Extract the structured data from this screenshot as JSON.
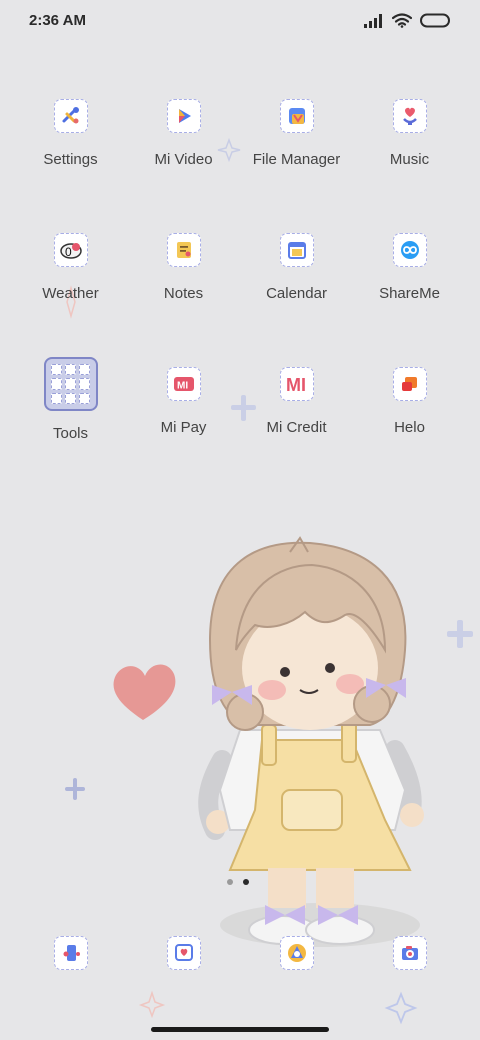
{
  "status_bar": {
    "time": "2:36 AM",
    "icons": [
      "signal-icon",
      "wifi-icon",
      "battery-icon"
    ]
  },
  "apps": [
    {
      "label": "Settings",
      "icon": "settings-icon"
    },
    {
      "label": "Mi Video",
      "icon": "play-icon"
    },
    {
      "label": "File Manager",
      "icon": "folder-icon"
    },
    {
      "label": "Music",
      "icon": "music-icon"
    },
    {
      "label": "Weather",
      "icon": "weather-icon"
    },
    {
      "label": "Notes",
      "icon": "notes-icon"
    },
    {
      "label": "Calendar",
      "icon": "calendar-icon"
    },
    {
      "label": "ShareMe",
      "icon": "shareme-icon"
    },
    {
      "label": "Tools",
      "icon": "folder-tools"
    },
    {
      "label": "Mi Pay",
      "icon": "mi-pay-icon",
      "glyph": "MI"
    },
    {
      "label": "Mi Credit",
      "icon": "mi-credit-icon",
      "glyph": "MI"
    },
    {
      "label": "Helo",
      "icon": "helo-icon"
    }
  ],
  "dock": [
    {
      "icon": "phone-icon"
    },
    {
      "icon": "messages-icon"
    },
    {
      "icon": "browser-icon"
    },
    {
      "icon": "camera-icon"
    }
  ],
  "page_indicator": {
    "pages": 2,
    "active": 2
  },
  "colors": {
    "background": "#e6e6e8",
    "icon_border": "#a8aee6",
    "folder_fill": "#c9cde8",
    "heart": "#e58a86"
  }
}
